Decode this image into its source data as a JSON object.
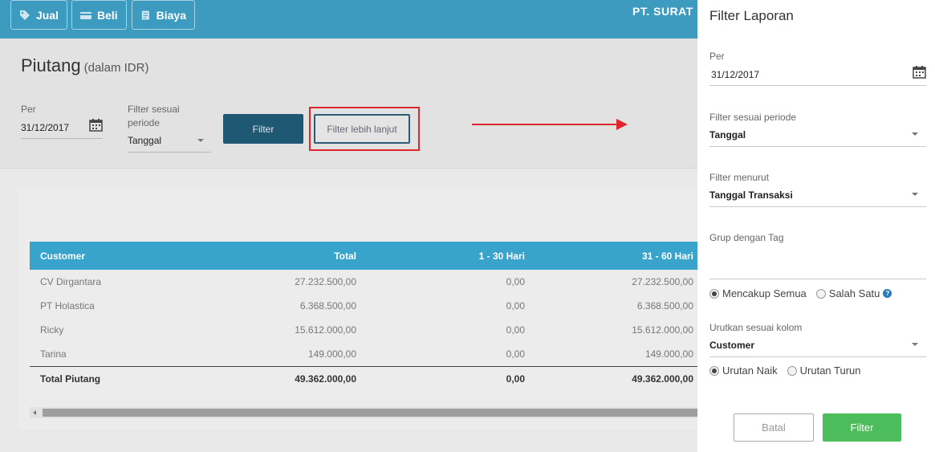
{
  "topbar": {
    "buttons": [
      {
        "label": "Jual",
        "icon": "tag-icon"
      },
      {
        "label": "Beli",
        "icon": "card-icon"
      },
      {
        "label": "Biaya",
        "icon": "receipt-icon"
      }
    ],
    "company": "PT. SURAT"
  },
  "page": {
    "title": "Piutang",
    "subtitle": "(dalam IDR)"
  },
  "filters": {
    "per_label": "Per",
    "per_value": "31/12/2017",
    "period_label_line1": "Filter sesuai",
    "period_label_line2": "periode",
    "period_value": "Tanggal",
    "filter_button": "Filter",
    "advanced_button": "Filter lebih lanjut"
  },
  "table": {
    "columns": [
      "Customer",
      "Total",
      "1 - 30 Hari",
      "31 - 60 Hari"
    ],
    "rows": [
      [
        "CV Dirgantara",
        "27.232.500,00",
        "0,00",
        "27.232.500,00"
      ],
      [
        "PT Holastica",
        "6.368.500,00",
        "0,00",
        "6.368.500,00"
      ],
      [
        "Ricky",
        "15.612.000,00",
        "0,00",
        "15.612.000,00"
      ],
      [
        "Tarina",
        "149.000,00",
        "0,00",
        "149.000,00"
      ]
    ],
    "total": [
      "Total Piutang",
      "49.362.000,00",
      "0,00",
      "49.362.000,00"
    ]
  },
  "panel": {
    "title": "Filter Laporan",
    "per_label": "Per",
    "per_value": "31/12/2017",
    "period_label": "Filter sesuai periode",
    "period_value": "Tanggal",
    "filter_by_label": "Filter menurut",
    "filter_by_value": "Tanggal Transaksi",
    "group_tag_label": "Grup dengan Tag",
    "match_all": "Mencakup Semua",
    "match_one": "Salah Satu",
    "sort_label": "Urutkan sesuai kolom",
    "sort_value": "Customer",
    "sort_asc": "Urutan Naik",
    "sort_desc": "Urutan Turun",
    "cancel_button": "Batal",
    "filter_button": "Filter"
  },
  "colors": {
    "topbar": "#3d9bbf",
    "table_header": "#39a4cb",
    "dark_button": "#1f5873",
    "highlight": "#e0262c",
    "green_button": "#4dbd5b"
  }
}
